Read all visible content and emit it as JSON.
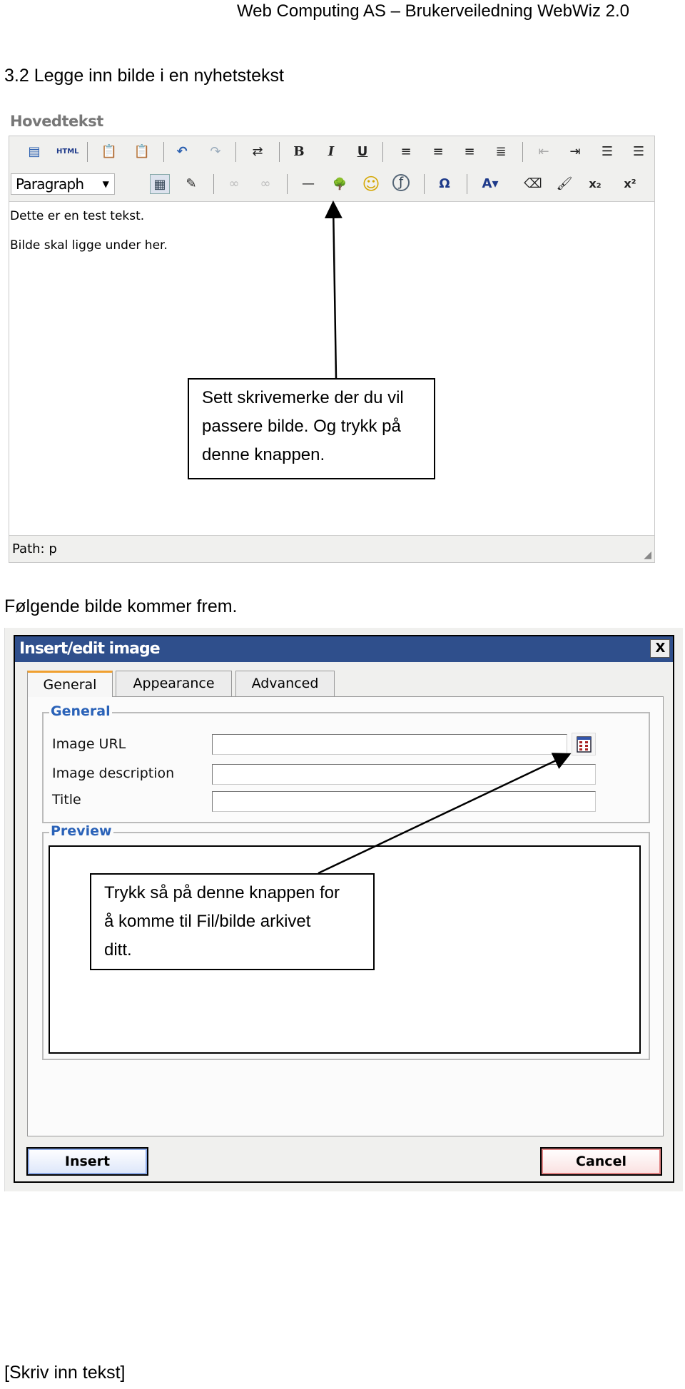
{
  "page_header": "Web Computing AS – Brukerveiledning WebWiz 2.0",
  "section_title": "3.2 Legge inn bilde i en nyhetstekst",
  "editor": {
    "label": "Hovedtekst",
    "toolbar_row1": [
      {
        "icon": "wysiwyg-icon",
        "glyph": "▤"
      },
      {
        "icon": "html-source-icon",
        "glyph": "HTML"
      },
      {
        "icon": "paste-text-icon",
        "glyph": "📋"
      },
      {
        "icon": "paste-word-icon",
        "glyph": "📋"
      },
      {
        "icon": "undo-icon",
        "glyph": "↶"
      },
      {
        "icon": "redo-icon",
        "glyph": "↷"
      },
      {
        "icon": "find-replace-icon",
        "glyph": "⇄"
      },
      {
        "icon": "bold-icon",
        "glyph": "B"
      },
      {
        "icon": "italic-icon",
        "glyph": "I"
      },
      {
        "icon": "underline-icon",
        "glyph": "U"
      },
      {
        "icon": "align-left-icon",
        "glyph": "≡"
      },
      {
        "icon": "align-center-icon",
        "glyph": "≡"
      },
      {
        "icon": "align-right-icon",
        "glyph": "≡"
      },
      {
        "icon": "align-justify-icon",
        "glyph": "≣"
      },
      {
        "icon": "outdent-icon",
        "glyph": "⇤"
      },
      {
        "icon": "indent-icon",
        "glyph": "⇥"
      },
      {
        "icon": "bullet-list-icon",
        "glyph": "☰"
      },
      {
        "icon": "numbered-list-icon",
        "glyph": "☰"
      }
    ],
    "format_select": "Paragraph",
    "toolbar_row2": [
      {
        "icon": "table-icon",
        "glyph": "▦"
      },
      {
        "icon": "edit-table-icon",
        "glyph": "✎"
      },
      {
        "icon": "link-icon",
        "glyph": "∞"
      },
      {
        "icon": "unlink-icon",
        "glyph": "∞"
      },
      {
        "icon": "horizontal-rule-icon",
        "glyph": "—"
      },
      {
        "icon": "insert-image-icon",
        "glyph": "🌳"
      },
      {
        "icon": "emoticon-icon",
        "glyph": "☺"
      },
      {
        "icon": "flash-icon",
        "glyph": "ƒ"
      },
      {
        "icon": "special-char-icon",
        "glyph": "Ω"
      },
      {
        "icon": "text-color-icon",
        "glyph": "A▾"
      },
      {
        "icon": "remove-format-icon",
        "glyph": "⌫"
      },
      {
        "icon": "cleanup-icon",
        "glyph": "🖌"
      },
      {
        "icon": "subscript-icon",
        "glyph": "x₂"
      },
      {
        "icon": "superscript-icon",
        "glyph": "x²"
      }
    ],
    "content_lines": [
      "Dette er en test tekst.",
      "Bilde skal ligge under her."
    ],
    "path": "Path: p"
  },
  "callout1": [
    "Sett skrivemerke der du vil",
    "passere bilde. Og trykk på",
    "denne knappen."
  ],
  "followup_text": "Følgende bilde kommer frem.",
  "dialog": {
    "title": "Insert/edit image",
    "close": "X",
    "tabs": [
      "General",
      "Appearance",
      "Advanced"
    ],
    "active_tab": "General",
    "general_legend": "General",
    "fields": [
      {
        "label": "Image URL",
        "value": ""
      },
      {
        "label": "Image description",
        "value": ""
      },
      {
        "label": "Title",
        "value": ""
      }
    ],
    "preview_legend": "Preview",
    "insert": "Insert",
    "cancel": "Cancel"
  },
  "callout2": [
    "Trykk så på denne knappen for",
    "å komme til Fil/bilde arkivet",
    "ditt."
  ],
  "footer": "[Skriv inn tekst]"
}
